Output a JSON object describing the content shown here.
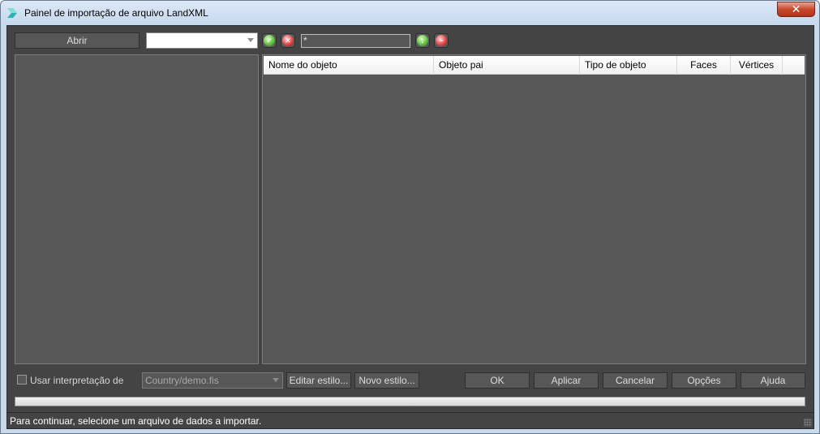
{
  "window": {
    "title": "Painel de importação de arquivo LandXML",
    "close_glyph": "✕",
    "accent": "#2bb3b1"
  },
  "toolbar": {
    "open_label": "Abrir",
    "file_combo_value": "",
    "accept_icon": "green-check-icon",
    "clear_icon": "red-x-icon",
    "filter_value": "*",
    "apply_filter_icon": "green-filter-icon",
    "remove_filter_icon": "red-minus-icon"
  },
  "table": {
    "columns": [
      {
        "label": "Nome do objeto"
      },
      {
        "label": "Objeto pai"
      },
      {
        "label": "Tipo de objeto"
      },
      {
        "label": "Faces"
      },
      {
        "label": "Vértices"
      }
    ],
    "rows": []
  },
  "options": {
    "use_interpretation_label": "Usar interpretação de",
    "use_interpretation_checked": false,
    "style_combo_value": "Country/demo.fis",
    "edit_style_label": "Editar estilo...",
    "new_style_label": "Novo estilo..."
  },
  "actions": {
    "ok_label": "OK",
    "apply_label": "Aplicar",
    "cancel_label": "Cancelar",
    "options_label": "Opções",
    "help_label": "Ajuda"
  },
  "progress": {
    "value": 0
  },
  "status": {
    "message": "Para continuar, selecione um arquivo de dados a importar."
  }
}
